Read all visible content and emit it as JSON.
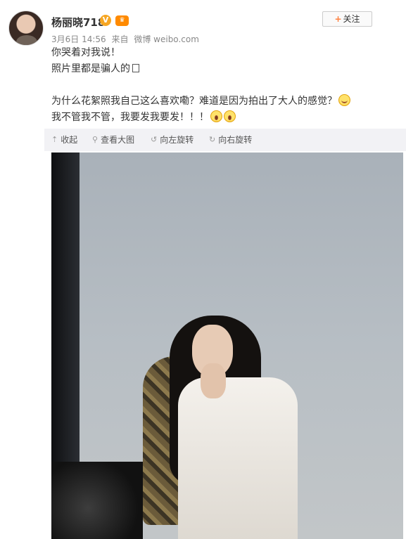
{
  "header": {
    "username": "杨丽晓718",
    "verified_icon": "v-badge-icon",
    "vip_icon": "vip-badge-icon",
    "date": "3月6日 14:56",
    "source_prefix": "来自",
    "source": "微博 weibo.com",
    "follow_label": "关注"
  },
  "post": {
    "line1": "你哭着对我说！",
    "line2": "照片里都是骗人的",
    "line3": "为什么花絮照我自己这么喜欢嘞？难道是因为拍出了大人的感觉？",
    "line4": "我不管我不管，我要发我要发！！！"
  },
  "toolbar": {
    "collapse": "收起",
    "view_large": "查看大图",
    "rotate_left": "向左旋转",
    "rotate_right": "向右旋转"
  },
  "colors": {
    "accent": "#ff8140",
    "toolbar_bg": "#f2f2f5",
    "meta": "#888888"
  }
}
